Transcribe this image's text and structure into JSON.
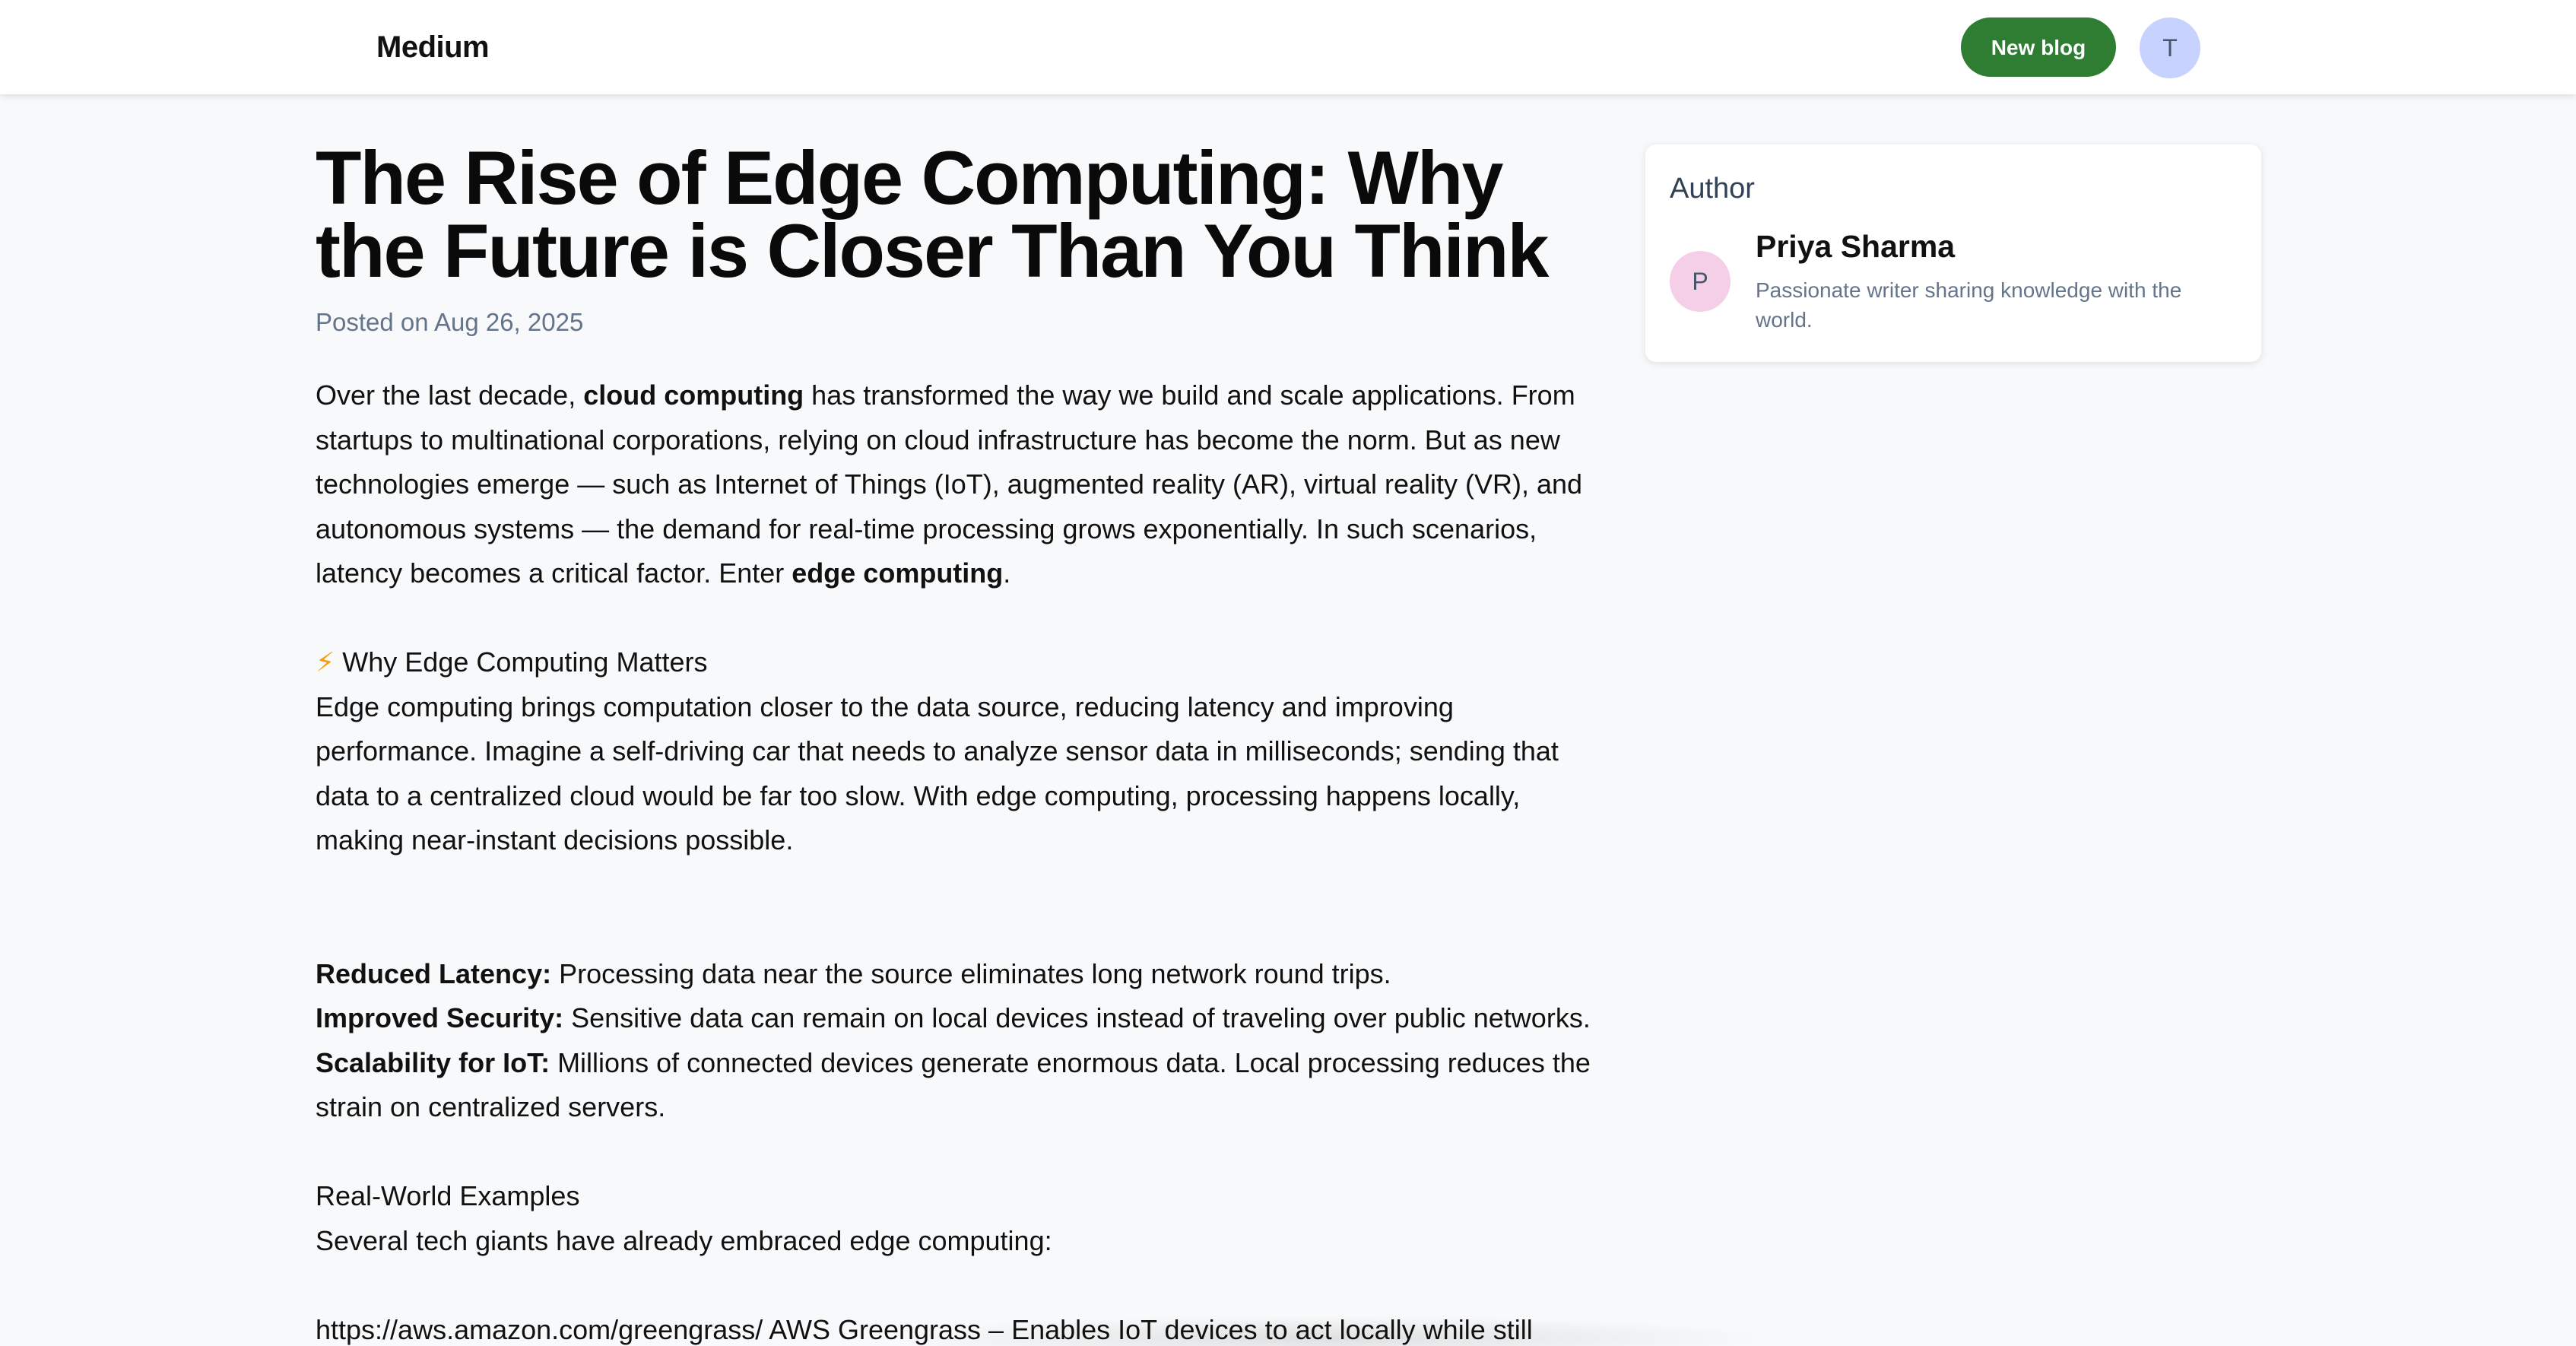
{
  "header": {
    "logo": "Medium",
    "new_blog_label": "New blog",
    "user_initial": "T"
  },
  "article": {
    "title_line1": "The Rise of Edge Computing: Why",
    "title_line2": "the Future is Closer Than You Think",
    "posted": "Posted on Aug 26, 2025",
    "intro": {
      "l1_a": "Over the last decade, ",
      "l1_b": "cloud computing",
      "l1_c": " has transformed the way we build and scale applications. From",
      "l2": "startups to multinational corporations, relying on cloud infrastructure has become the norm. But as new",
      "l3": "technologies emerge — such as Internet of Things (IoT), augmented reality (AR), virtual reality (VR), and",
      "l4": "autonomous systems — the demand for real-time processing grows exponentially. In such scenarios,",
      "l5_a": "latency becomes a critical factor. Enter ",
      "l5_b": "edge computing",
      "l5_c": "."
    },
    "why": {
      "icon": "⚡",
      "heading": " Why Edge Computing Matters",
      "l1": "Edge computing brings computation closer to the data source, reducing latency and improving",
      "l2": "performance. Imagine a self-driving car that needs to analyze sensor data in milliseconds; sending that",
      "l3": "data to a centralized cloud would be far too slow. With edge computing, processing happens locally,",
      "l4": "making near-instant decisions possible."
    },
    "benefits": [
      {
        "label": "Reduced Latency:",
        "text": " Processing data near the source eliminates long network round trips."
      },
      {
        "label": "Improved Security:",
        "text": " Sensitive data can remain on local devices instead of traveling over public networks."
      },
      {
        "label": "Scalability for IoT:",
        "text": " Millions of connected devices generate enormous data. Local processing reduces the"
      }
    ],
    "benefit3_cont": "strain on centralized servers.",
    "examples": {
      "heading": "Real-World Examples",
      "intro": "Several tech giants have already embraced edge computing:",
      "cut_line": "https://aws.amazon.com/greengrass/ AWS Greengrass – Enables IoT devices to act locally while still"
    }
  },
  "author": {
    "heading": "Author",
    "initial": "P",
    "name": "Priya Sharma",
    "bio": "Passionate writer sharing knowledge with the world."
  },
  "colors": {
    "accent": "#2e7d32",
    "user_avatar_bg": "#c7d2fe",
    "author_avatar_bg": "#f5cfe8",
    "page_bg": "#f8f9fa"
  }
}
